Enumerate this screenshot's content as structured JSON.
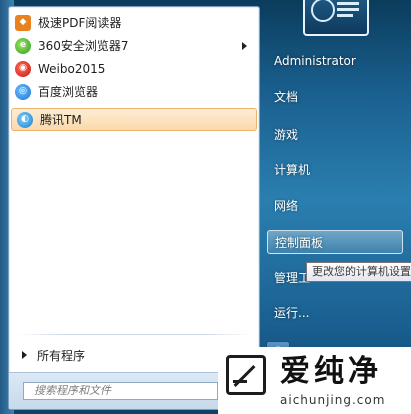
{
  "pinned_programs": [
    {
      "label": "极速PDF阅读器",
      "icon": "pdf-reader-icon"
    },
    {
      "label": "360安全浏览器7",
      "icon": "360-browser-icon",
      "has_submenu": true
    },
    {
      "label": "Weibo2015",
      "icon": "weibo-icon"
    },
    {
      "label": "百度浏览器",
      "icon": "baidu-browser-icon"
    },
    {
      "label": "腾讯TM",
      "icon": "tencent-tm-icon",
      "selected": true
    }
  ],
  "all_programs_label": "所有程序",
  "search": {
    "placeholder": "搜索程序和文件"
  },
  "right_menu": [
    {
      "label": "Administrator"
    },
    {
      "label": "文档"
    },
    {
      "label": "游戏"
    },
    {
      "label": "计算机"
    },
    {
      "label": "网络"
    },
    {
      "label": "控制面板",
      "highlighted": true
    },
    {
      "label": "管理工"
    },
    {
      "label": "运行..."
    }
  ],
  "tooltip": "更改您的计算机设置",
  "watermark": {
    "name": "爱纯净",
    "url": "aichunjing.com"
  }
}
